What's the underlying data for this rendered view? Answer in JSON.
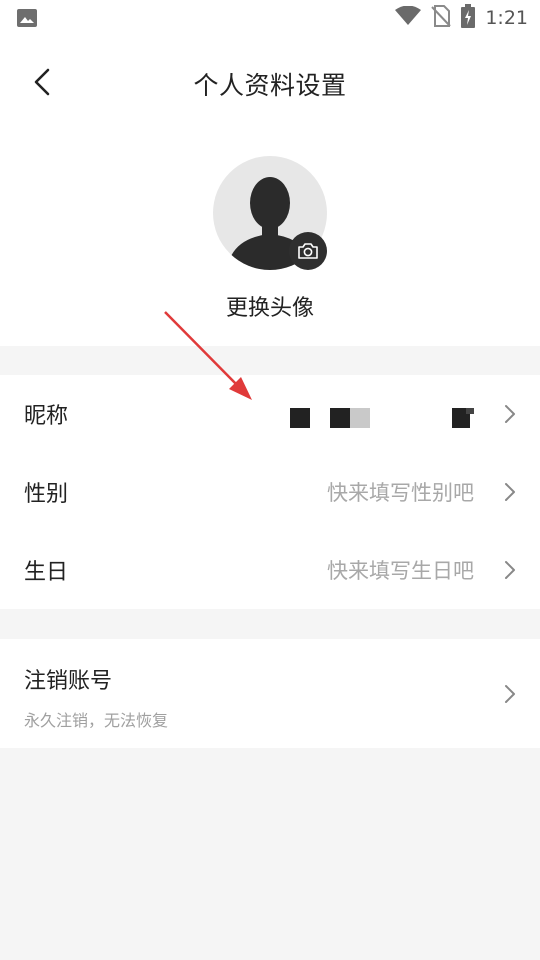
{
  "status_bar": {
    "time": "1:21",
    "icons": [
      "image-icon",
      "wifi-icon",
      "no-sim-icon",
      "battery-charging-icon"
    ]
  },
  "header": {
    "title": "个人资料设置",
    "back_icon": "chevron-left-icon"
  },
  "avatar": {
    "change_label": "更换头像",
    "icon": "default-avatar-icon",
    "badge_icon": "camera-icon"
  },
  "profile_rows": [
    {
      "label": "昵称",
      "value": ""
    },
    {
      "label": "性别",
      "value": "快来填写性别吧"
    },
    {
      "label": "生日",
      "value": "快来填写生日吧"
    }
  ],
  "account": {
    "label": "注销账号",
    "subtitle": "永久注销，无法恢复"
  },
  "colors": {
    "background": "#f5f5f5",
    "card": "#ffffff",
    "annotation_arrow": "#e03a3a",
    "placeholder_text": "#a8a8a8"
  }
}
